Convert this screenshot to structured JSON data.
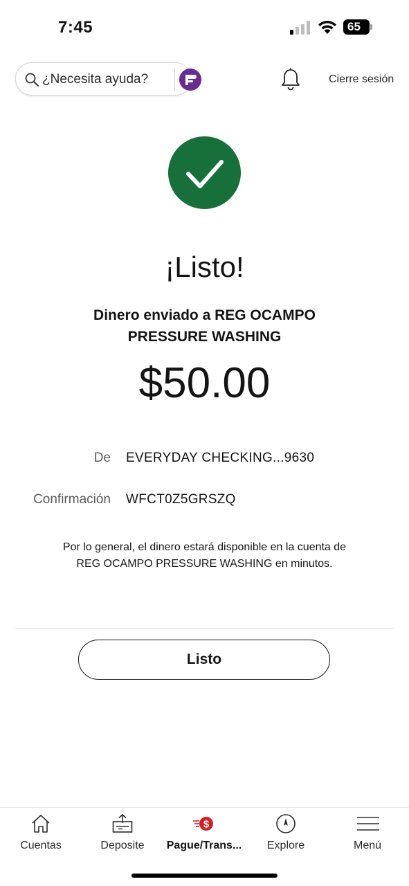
{
  "status_bar": {
    "time": "7:45",
    "battery": "65"
  },
  "header": {
    "help_placeholder": "¿Necesita ayuda?",
    "logout_label": "Cierre sesión"
  },
  "confirmation": {
    "title": "¡Listo!",
    "sent_to": "Dinero enviado a REG OCAMPO PRESSURE WASHING",
    "amount": "$50.00",
    "details": [
      {
        "label": "De",
        "value": "EVERYDAY CHECKING...9630"
      },
      {
        "label": "Confirmación",
        "value": "WFCT0Z5GRSZQ"
      }
    ],
    "note": "Por lo general, el dinero estará disponible en la cuenta de REG OCAMPO PRESSURE WASHING en minutos.",
    "done_label": "Listo"
  },
  "tabs": [
    {
      "label": "Cuentas",
      "icon": "home-icon",
      "active": false
    },
    {
      "label": "Deposite",
      "icon": "deposit-icon",
      "active": false
    },
    {
      "label": "Pague/Trans...",
      "icon": "pay-transfer-icon",
      "active": true
    },
    {
      "label": "Explore",
      "icon": "compass-icon",
      "active": false
    },
    {
      "label": "Menú",
      "icon": "menu-icon",
      "active": false
    }
  ],
  "colors": {
    "success_green": "#17703a",
    "brand_red": "#d71e28",
    "fargo_purple": "#6b2c91"
  }
}
